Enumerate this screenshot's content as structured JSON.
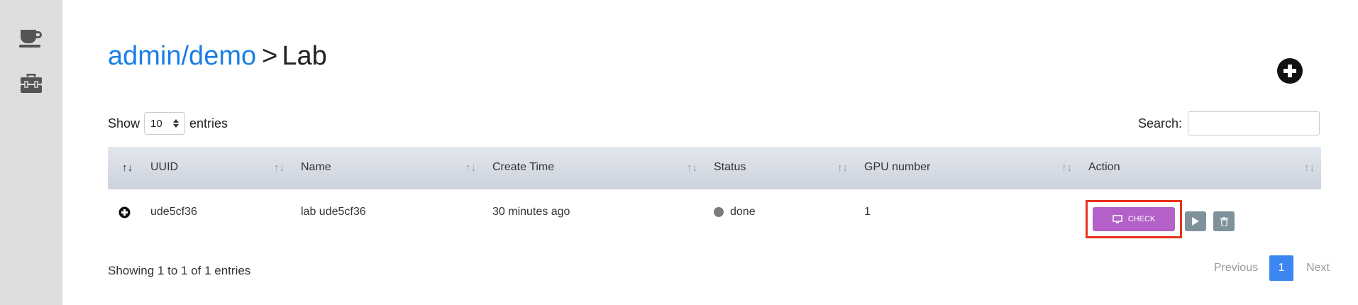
{
  "sidebar": {
    "items": [
      {
        "icon": "coffee-cup-icon"
      },
      {
        "icon": "toolbox-icon"
      }
    ]
  },
  "breadcrumb": {
    "parent": "admin/demo",
    "separator": ">",
    "current": "Lab"
  },
  "add_button": {
    "icon": "plus-circle-icon"
  },
  "length": {
    "show_label": "Show",
    "value": "10",
    "entries_label": "entries"
  },
  "search": {
    "label": "Search:",
    "value": ""
  },
  "table": {
    "columns": [
      "UUID",
      "Name",
      "Create Time",
      "Status",
      "GPU number",
      "Action"
    ],
    "rows": [
      {
        "uuid": "ude5cf36",
        "name": "lab ude5cf36",
        "create_time": "30 minutes ago",
        "status": "done",
        "gpu": "1",
        "check_label": "CHECK"
      }
    ]
  },
  "colors": {
    "link": "#1a7fe6",
    "check": "#b361c8",
    "highlight": "#e8321f",
    "page_active": "#3b86f2",
    "icon_button": "#7f929b"
  },
  "footer": {
    "info": "Showing 1 to 1 of 1 entries",
    "previous": "Previous",
    "page": "1",
    "next": "Next"
  }
}
